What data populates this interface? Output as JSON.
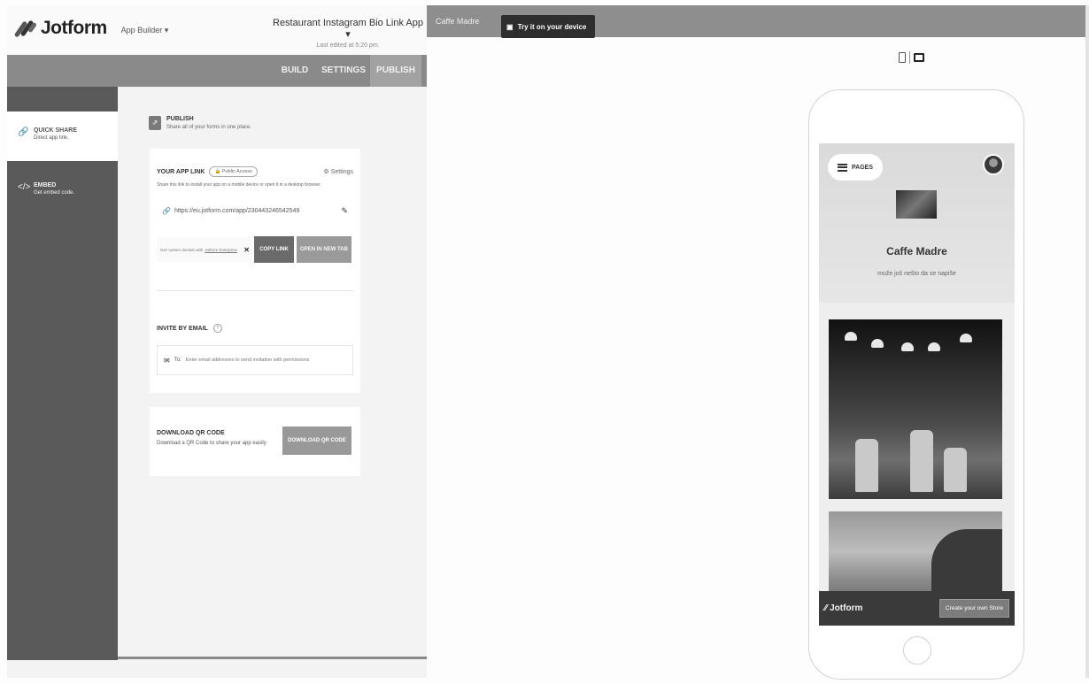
{
  "header": {
    "logo_text": "Jotform",
    "app_builder_label": "App Builder ▾",
    "app_title": "Restaurant Instagram Bio Link App ▾",
    "last_edited": "Last edited at 5:20 pm."
  },
  "tabs": [
    {
      "label": "BUILD"
    },
    {
      "label": "SETTINGS"
    },
    {
      "label": "PUBLISH",
      "active": true
    }
  ],
  "sidebar": {
    "items": [
      {
        "title": "QUICK SHARE",
        "subtitle": "Direct app link.",
        "icon": "link-icon",
        "active": true
      },
      {
        "title": "EMBED",
        "subtitle": "Get embed code.",
        "icon": "code-icon",
        "active": false
      }
    ]
  },
  "publish": {
    "title": "PUBLISH",
    "subtitle": "Share all of your forms in one place.",
    "app_link": {
      "label": "YOUR APP LINK",
      "access_badge": "🔒 Public Access",
      "settings_label": "⚙ Settings",
      "description": "Share this link to install your app on a mobile device or open it in a desktop browser.",
      "url": "https://eu.jotform.com/app/230443246542549",
      "custom_domain_text": "Get custom domain with",
      "custom_domain_link": "Jotform Enterprise",
      "copy_button": "COPY LINK",
      "open_button": "OPEN IN NEW TAB"
    },
    "invite": {
      "label": "INVITE BY EMAIL",
      "info": "?",
      "to_label": "To:",
      "placeholder": "Enter email addresses to send invitation with permissions"
    },
    "qr": {
      "title": "DOWNLOAD QR CODE",
      "description": "Download a QR Code to share your app easily",
      "button": "DOWNLOAD QR CODE"
    }
  },
  "preview": {
    "app_name": "Caffe Madre",
    "try_device_label": "Try it on your device",
    "pages_label": "PAGES",
    "cafe_title": "Caffe Madre",
    "cafe_subtitle": "može još nešto da se napiše",
    "promo_logo": "Jotform",
    "promo_button": "Create your own Store"
  },
  "colors": {
    "topbar": "#8e8e8e",
    "sidebar": "#5a5a5a",
    "accent_button": "#6a6a6a",
    "promo_bar": "#3a3a3a"
  }
}
